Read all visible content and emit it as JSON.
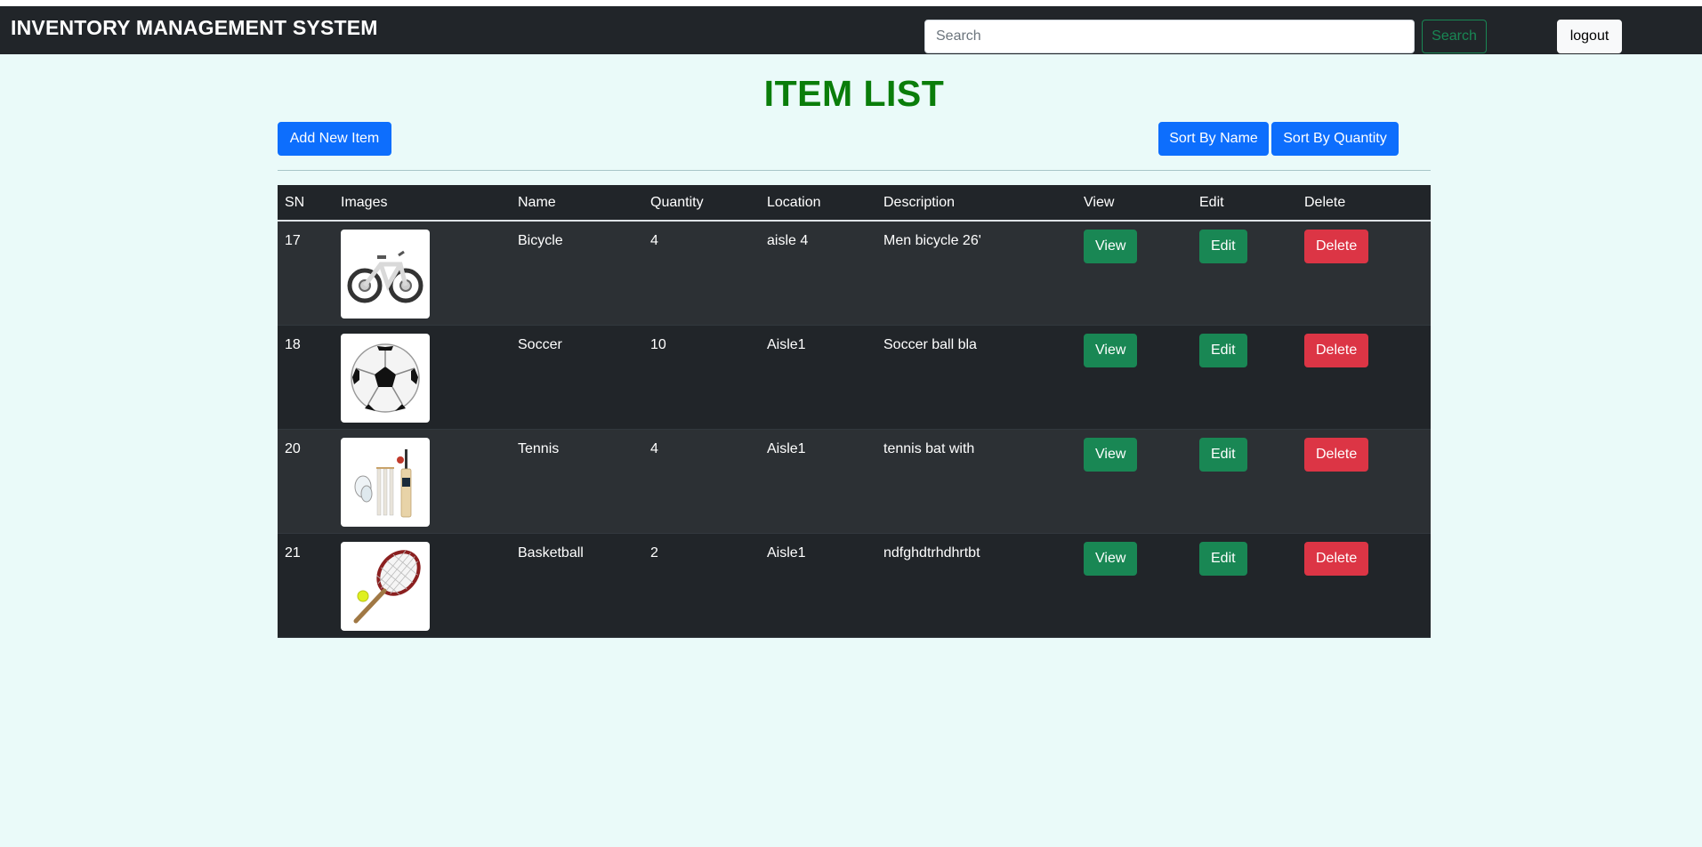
{
  "navbar": {
    "brand": "INVENTORY MANAGEMENT SYSTEM",
    "search_placeholder": "Search",
    "search_button": "Search",
    "logout_button": "logout"
  },
  "page": {
    "title": "ITEM LIST",
    "add_button": "Add New Item",
    "sort_name_button": "Sort By Name",
    "sort_quantity_button": "Sort By Quantity"
  },
  "table": {
    "headers": [
      "SN",
      "Images",
      "Name",
      "Quantity",
      "Location",
      "Description",
      "View",
      "Edit",
      "Delete"
    ],
    "rows": [
      {
        "sn": "17",
        "image": "bicycle-image",
        "name": "Bicycle",
        "quantity": "4",
        "location": "aisle 4",
        "description": "Men bicycle 26'",
        "view": "View",
        "edit": "Edit",
        "delete": "Delete"
      },
      {
        "sn": "18",
        "image": "soccer-ball-image",
        "name": "Soccer",
        "quantity": "10",
        "location": "Aisle1",
        "description": "Soccer ball bla",
        "view": "View",
        "edit": "Edit",
        "delete": "Delete"
      },
      {
        "sn": "20",
        "image": "cricket-kit-image",
        "name": "Tennis",
        "quantity": "4",
        "location": "Aisle1",
        "description": "tennis bat with",
        "view": "View",
        "edit": "Edit",
        "delete": "Delete"
      },
      {
        "sn": "21",
        "image": "tennis-racket-image",
        "name": "Basketball",
        "quantity": "2",
        "location": "Aisle1",
        "description": "ndfghdtrhdhrtbt",
        "view": "View",
        "edit": "Edit",
        "delete": "Delete"
      }
    ]
  },
  "colors": {
    "navbar_bg": "#212529",
    "page_bg": "#eafaf9",
    "title_green": "#0a7d0a",
    "primary": "#0d6efd",
    "success": "#198754",
    "danger": "#dc3545"
  }
}
